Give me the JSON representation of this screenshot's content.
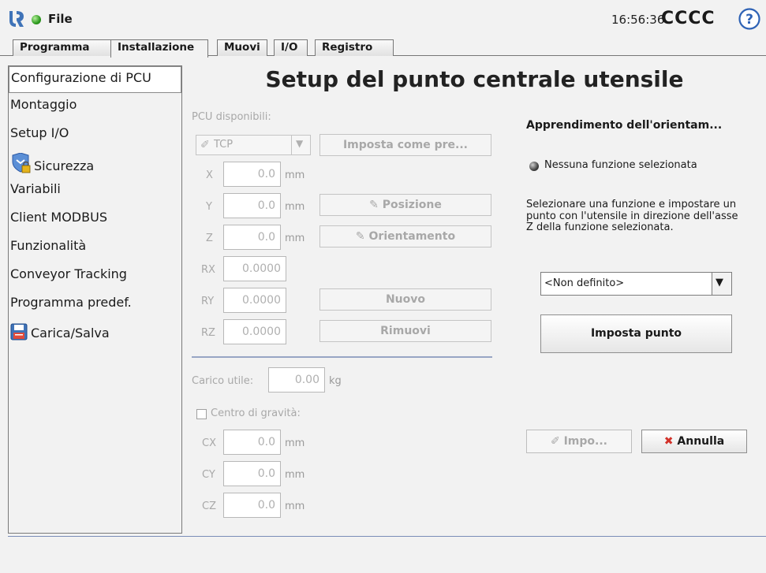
{
  "header": {
    "file_label": "File",
    "clock": "16:56:36",
    "robot_name": "CCCC"
  },
  "tabs": [
    {
      "label": "Programma"
    },
    {
      "label": "Installazione"
    },
    {
      "label": "Muovi"
    },
    {
      "label": "I/O"
    },
    {
      "label": "Registro"
    }
  ],
  "sidebar": {
    "items": [
      {
        "label": "Configurazione di PCU"
      },
      {
        "label": "Montaggio"
      },
      {
        "label": "Setup I/O"
      },
      {
        "label": "Sicurezza"
      },
      {
        "label": "Variabili"
      },
      {
        "label": "Client MODBUS"
      },
      {
        "label": "Funzionalità"
      },
      {
        "label": "Conveyor Tracking"
      },
      {
        "label": "Programma predef."
      },
      {
        "label": "Carica/Salva"
      }
    ]
  },
  "main": {
    "title": "Setup del punto centrale utensile",
    "tcp_available_label": "PCU disponibili:",
    "tcp_select_value": "TCP",
    "set_default_button": "Imposta come pre...",
    "position_button": "Posizione",
    "orientation_button": "Orientamento",
    "new_button": "Nuovo",
    "remove_button": "Rimuovi",
    "coords": {
      "x": {
        "label": "X",
        "value": "0.0",
        "unit": "mm"
      },
      "y": {
        "label": "Y",
        "value": "0.0",
        "unit": "mm"
      },
      "z": {
        "label": "Z",
        "value": "0.0",
        "unit": "mm"
      },
      "rx": {
        "label": "RX",
        "value": "0.0000"
      },
      "ry": {
        "label": "RY",
        "value": "0.0000"
      },
      "rz": {
        "label": "RZ",
        "value": "0.0000"
      }
    },
    "payload_label": "Carico utile:",
    "payload_value": "0.00",
    "payload_unit": "kg",
    "cog_label": "Centro di gravità:",
    "cog": {
      "cx": {
        "label": "CX",
        "value": "0.0",
        "unit": "mm"
      },
      "cy": {
        "label": "CY",
        "value": "0.0",
        "unit": "mm"
      },
      "cz": {
        "label": "CZ",
        "value": "0.0",
        "unit": "mm"
      }
    }
  },
  "orientation_panel": {
    "title": "Apprendimento dell'orientam...",
    "status": "Nessuna funzione selezionata",
    "instructions": "Selezionare una funzione e impostare un punto con l'utensile in direzione dell'asse Z della funzione selezionata.",
    "feature_select_value": "<Non definito>",
    "set_point_button": "Imposta punto",
    "apply_button": "Impo...",
    "cancel_button": "Annulla"
  }
}
